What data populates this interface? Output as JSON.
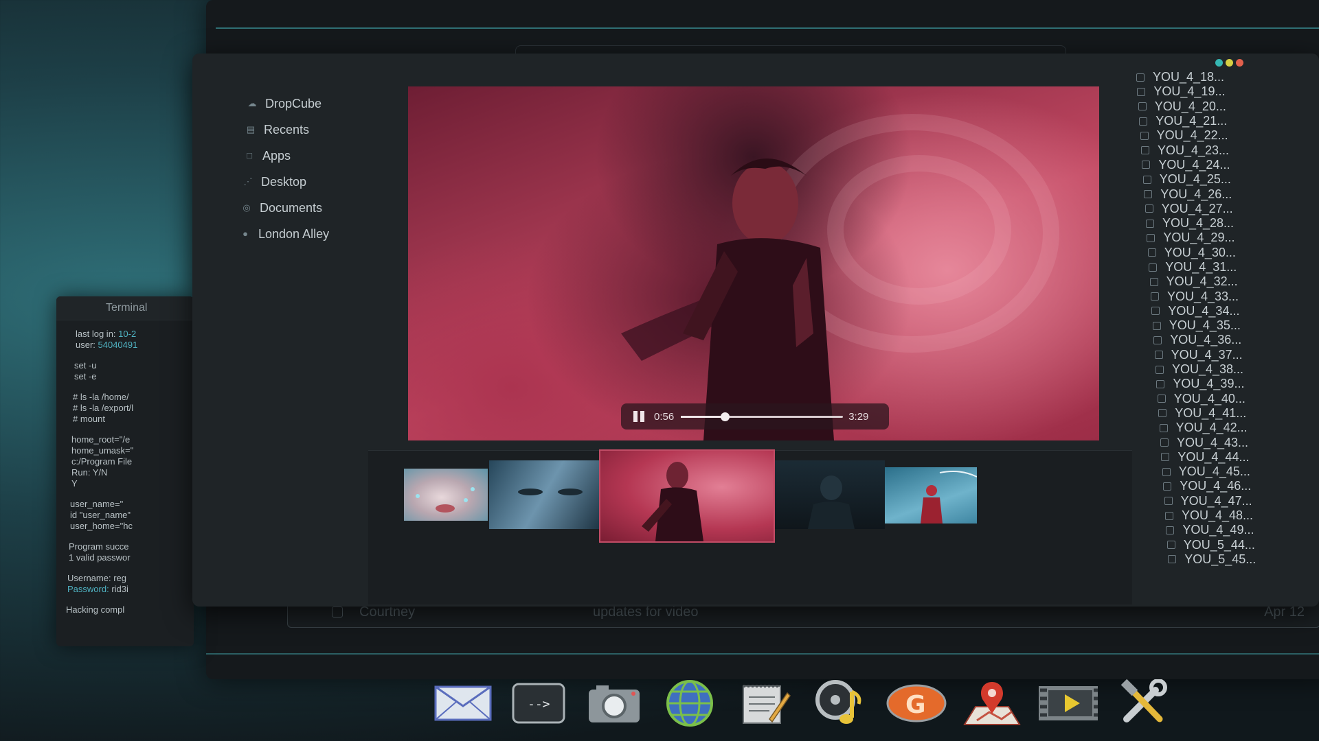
{
  "terminal": {
    "title": "Terminal",
    "lines": [
      [
        "last log in: 10-2",
        "user: 54040491"
      ],
      [
        "set -u",
        "set -e"
      ],
      [
        "# ls -la /home/",
        "# ls -la /export/l",
        "# mount"
      ],
      [
        "home_root=\"/e",
        "home_umask=\"",
        "c:/Program File",
        "Run: Y/N",
        "Y"
      ],
      [
        "user_name=\"",
        "id \"user_name\"",
        "user_home=\"hc"
      ],
      [
        "Program succe",
        "1 valid passwor"
      ],
      [
        "Username: reg",
        "Password: rid3i"
      ],
      [
        "Hacking compl"
      ]
    ]
  },
  "sidebar": {
    "items": [
      {
        "label": "DropCube",
        "icon": "cloud-icon"
      },
      {
        "label": "Recents",
        "icon": "clock-icon"
      },
      {
        "label": "Apps",
        "icon": "apps-icon"
      },
      {
        "label": "Desktop",
        "icon": "desktop-icon"
      },
      {
        "label": "Documents",
        "icon": "document-icon"
      },
      {
        "label": "London Alley",
        "icon": "folder-icon"
      }
    ]
  },
  "player": {
    "current_time": "0:56",
    "duration": "3:29",
    "progress": 0.27
  },
  "mail_row": {
    "sender": "Courtney",
    "subject": "updates for video",
    "date": "Apr 12"
  },
  "files": [
    "YOU_4_18...",
    "YOU_4_19...",
    "YOU_4_20...",
    "YOU_4_21...",
    "YOU_4_22...",
    "YOU_4_23...",
    "YOU_4_24...",
    "YOU_4_25...",
    "YOU_4_26...",
    "YOU_4_27...",
    "YOU_4_28...",
    "YOU_4_29...",
    "YOU_4_30...",
    "YOU_4_31...",
    "YOU_4_32...",
    "YOU_4_33...",
    "YOU_4_34...",
    "YOU_4_35...",
    "YOU_4_36...",
    "YOU_4_37...",
    "YOU_4_38...",
    "YOU_4_39...",
    "YOU_4_40...",
    "YOU_4_41...",
    "YOU_4_42...",
    "YOU_4_43...",
    "YOU_4_44...",
    "YOU_4_45...",
    "YOU_4_46...",
    "YOU_4_47...",
    "YOU_4_48...",
    "YOU_4_49...",
    "YOU_5_44...",
    "YOU_5_45..."
  ],
  "window_dots": [
    "#35b7b3",
    "#d6cf43",
    "#e2604c"
  ],
  "dock": [
    {
      "name": "mail-icon"
    },
    {
      "name": "terminal-icon"
    },
    {
      "name": "camera-icon"
    },
    {
      "name": "globe-icon"
    },
    {
      "name": "notepad-icon"
    },
    {
      "name": "music-icon"
    },
    {
      "name": "g-app-icon"
    },
    {
      "name": "maps-icon"
    },
    {
      "name": "video-player-icon"
    },
    {
      "name": "settings-tools-icon"
    }
  ]
}
